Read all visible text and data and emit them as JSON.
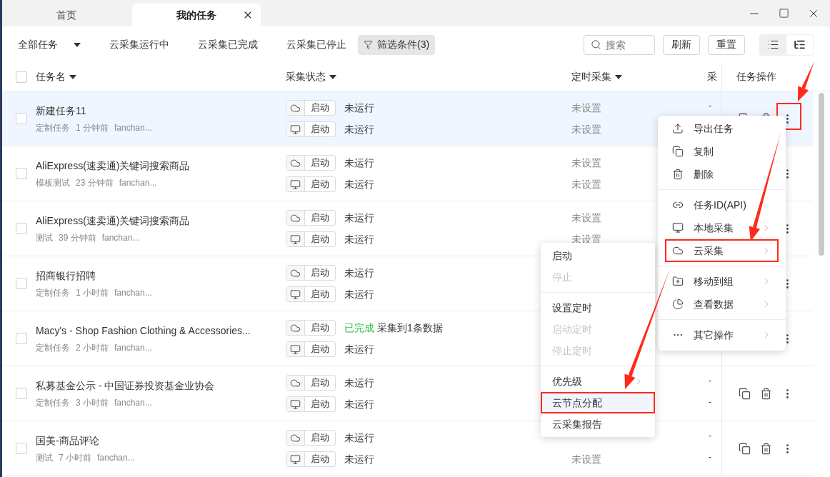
{
  "tabs": [
    {
      "label": "首页",
      "selected": false,
      "closable": false
    },
    {
      "label": "我的任务",
      "selected": true,
      "closable": true
    }
  ],
  "toolbar": {
    "dropdown": "全部任务",
    "filters": [
      "云采集运行中",
      "云采集已完成",
      "云采集已停止"
    ],
    "filter_button": "筛选条件(3)",
    "search": {
      "placeholder": "搜索"
    },
    "buttons": [
      "刷新",
      "重置"
    ],
    "view_modes": [
      {
        "kind": "list",
        "selected": false
      },
      {
        "kind": "tree",
        "selected": true
      }
    ]
  },
  "table": {
    "select_all": {
      "checked": false
    },
    "columns": [
      {
        "label": "任务名",
        "sort": true
      },
      {
        "label": "采集状态",
        "sort": true
      },
      {
        "label": "定时采集",
        "sort": true
      },
      {
        "label": "采",
        "sort": false
      },
      {
        "label": "任务操作",
        "sort": false
      }
    ],
    "rows": [
      {
        "selected": true,
        "checked": false,
        "name": "新建任务11",
        "type": "定制任务",
        "time": "1 分钟前",
        "owner": "fanchan...",
        "runs": [
          {
            "kind": "cloud",
            "button": "启动",
            "status": "未运行",
            "done": false
          },
          {
            "kind": "local",
            "button": "启动",
            "status": "未运行",
            "done": false
          }
        ],
        "timed": [
          "未设置",
          "未设置"
        ],
        "collected": [
          "-"
        ]
      },
      {
        "selected": false,
        "checked": false,
        "name": "AliExpress(速卖通)关键词搜索商品",
        "type": "模板测试",
        "time": "23 分钟前",
        "owner": "fanchan...",
        "runs": [
          {
            "kind": "cloud",
            "button": "启动",
            "status": "未运行",
            "done": false
          },
          {
            "kind": "local",
            "button": "启动",
            "status": "未运行",
            "done": false
          }
        ],
        "timed": [
          "未设置",
          "未设置"
        ],
        "collected": []
      },
      {
        "selected": false,
        "checked": false,
        "name": "AliExpress(速卖通)关键词搜索商品",
        "type": "测试",
        "time": "39 分钟前",
        "owner": "fanchan...",
        "runs": [
          {
            "kind": "cloud",
            "button": "启动",
            "status": "未运行",
            "done": false
          },
          {
            "kind": "local",
            "button": "启动",
            "status": "未运行",
            "done": false
          }
        ],
        "timed": [
          "未设置",
          "未设置"
        ],
        "collected": []
      },
      {
        "selected": false,
        "checked": false,
        "name": "招商银行招聘",
        "type": "定制任务",
        "time": "1 小时前",
        "owner": "fanchan...",
        "runs": [
          {
            "kind": "cloud",
            "button": "启动",
            "status": "未运行",
            "done": false
          },
          {
            "kind": "local",
            "button": "启动",
            "status": "未运行",
            "done": false
          }
        ],
        "timed": [],
        "collected": []
      },
      {
        "selected": false,
        "checked": false,
        "name": "Macy's - Shop Fashion Clothing & Accessories...",
        "type": "定制任务",
        "time": "2 小时前",
        "owner": "fanchan...",
        "runs": [
          {
            "kind": "cloud",
            "button": "启动",
            "status": "已完成",
            "done": true,
            "note": "采集到1条数据"
          },
          {
            "kind": "local",
            "button": "启动",
            "status": "未运行",
            "done": false
          }
        ],
        "timed": [],
        "collected": []
      },
      {
        "selected": false,
        "checked": false,
        "name": "私募基金公示 - 中国证券投资基金业协会",
        "type": "定制任务",
        "time": "3 小时前",
        "owner": "fanchan...",
        "runs": [
          {
            "kind": "cloud",
            "button": "启动",
            "status": "未运行",
            "done": false
          },
          {
            "kind": "local",
            "button": "启动",
            "status": "未运行",
            "done": false
          }
        ],
        "timed": [],
        "collected": [
          "-",
          "-"
        ]
      },
      {
        "selected": false,
        "checked": false,
        "name": "国美-商品评论",
        "type": "测试",
        "time": "7 小时前",
        "owner": "fanchan...",
        "runs": [
          {
            "kind": "cloud",
            "button": "启动",
            "status": "未运行",
            "done": false
          },
          {
            "kind": "local",
            "button": "启动",
            "status": "未运行",
            "done": false
          }
        ],
        "timed": [
          "未设置"
        ],
        "collected": [
          "-",
          "-"
        ]
      }
    ]
  },
  "context_menu": {
    "items": [
      {
        "kind": "item",
        "label": "导出任务",
        "has_submenu": false,
        "selected": false
      },
      {
        "kind": "item",
        "label": "复制",
        "has_submenu": false,
        "selected": false
      },
      {
        "kind": "item",
        "label": "删除",
        "has_submenu": false,
        "selected": false
      },
      {
        "kind": "divider"
      },
      {
        "kind": "item",
        "label": "任务ID(API)",
        "has_submenu": false,
        "selected": false
      },
      {
        "kind": "item",
        "label": "本地采集",
        "has_submenu": true,
        "selected": false
      },
      {
        "kind": "item",
        "label": "云采集",
        "has_submenu": true,
        "selected": true
      },
      {
        "kind": "divider"
      },
      {
        "kind": "item",
        "label": "移动到组",
        "has_submenu": true,
        "selected": false
      },
      {
        "kind": "item",
        "label": "查看数据",
        "has_submenu": true,
        "selected": false
      },
      {
        "kind": "divider"
      },
      {
        "kind": "item",
        "label": "其它操作",
        "has_submenu": true,
        "selected": false
      }
    ]
  },
  "submenu": {
    "items": [
      {
        "kind": "item",
        "label": "启动",
        "disabled": false,
        "has_submenu": false,
        "selected": false
      },
      {
        "kind": "item",
        "label": "停止",
        "disabled": true,
        "has_submenu": false,
        "selected": false
      },
      {
        "kind": "divider"
      },
      {
        "kind": "item",
        "label": "设置定时",
        "disabled": false,
        "has_submenu": false,
        "selected": false
      },
      {
        "kind": "item",
        "label": "启动定时",
        "disabled": true,
        "has_submenu": false,
        "selected": false
      },
      {
        "kind": "item",
        "label": "停止定时",
        "disabled": true,
        "has_submenu": false,
        "selected": false
      },
      {
        "kind": "divider"
      },
      {
        "kind": "item",
        "label": "优先级",
        "disabled": false,
        "has_submenu": true,
        "selected": false
      },
      {
        "kind": "item",
        "label": "云节点分配",
        "disabled": false,
        "has_submenu": false,
        "selected": true
      },
      {
        "kind": "item",
        "label": "云采集报告",
        "disabled": false,
        "has_submenu": false,
        "selected": false
      }
    ]
  }
}
